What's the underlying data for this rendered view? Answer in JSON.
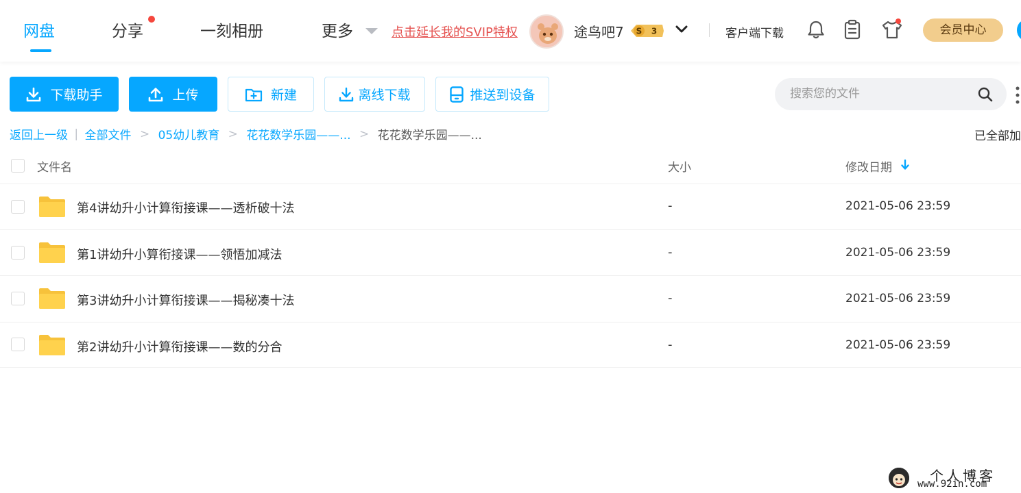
{
  "nav": {
    "tabs": [
      {
        "label": "网盘",
        "active": true
      },
      {
        "label": "分享",
        "has_dot": true
      },
      {
        "label": "一刻相册"
      },
      {
        "label": "更多"
      }
    ],
    "promo": "点击延长我的SVIP特权",
    "user": {
      "name": "途鸟吧7",
      "badge_symbol": "S",
      "badge_level": "3"
    },
    "client_download": "客户端下载",
    "icons": [
      "bell-icon",
      "clipboard-icon",
      "tshirt-icon"
    ],
    "member_center": "会员中心"
  },
  "toolbar": {
    "download_helper": "下载助手",
    "upload": "上传",
    "new": "新建",
    "offline_download": "离线下载",
    "push_to_device": "推送到设备"
  },
  "search": {
    "placeholder": "搜索您的文件"
  },
  "breadcrumb": {
    "back": "返回上一级",
    "items": [
      "全部文件",
      "05幼儿教育",
      "花花数学乐园——..."
    ],
    "current": "花花数学乐园——..."
  },
  "loaded_text": "已全部加",
  "table": {
    "headers": {
      "name": "文件名",
      "size": "大小",
      "modified": "修改日期"
    },
    "rows": [
      {
        "name": "第4讲幼升小计算衔接课——透析破十法",
        "size": "-",
        "modified": "2021-05-06 23:59"
      },
      {
        "name": "第1讲幼升小算衔接课——领悟加减法",
        "size": "-",
        "modified": "2021-05-06 23:59"
      },
      {
        "name": "第3讲幼升小计算衔接课——揭秘凑十法",
        "size": "-",
        "modified": "2021-05-06 23:59"
      },
      {
        "name": "第2讲幼升小计算衔接课——数的分合",
        "size": "-",
        "modified": "2021-05-06 23:59"
      }
    ]
  },
  "watermark": {
    "title": "个人博客",
    "url": "www.92in.com"
  },
  "colors": {
    "accent": "#06a7ff",
    "promo": "#e5514f",
    "member": "#f2cd8d",
    "folder": "#ffd24d"
  }
}
